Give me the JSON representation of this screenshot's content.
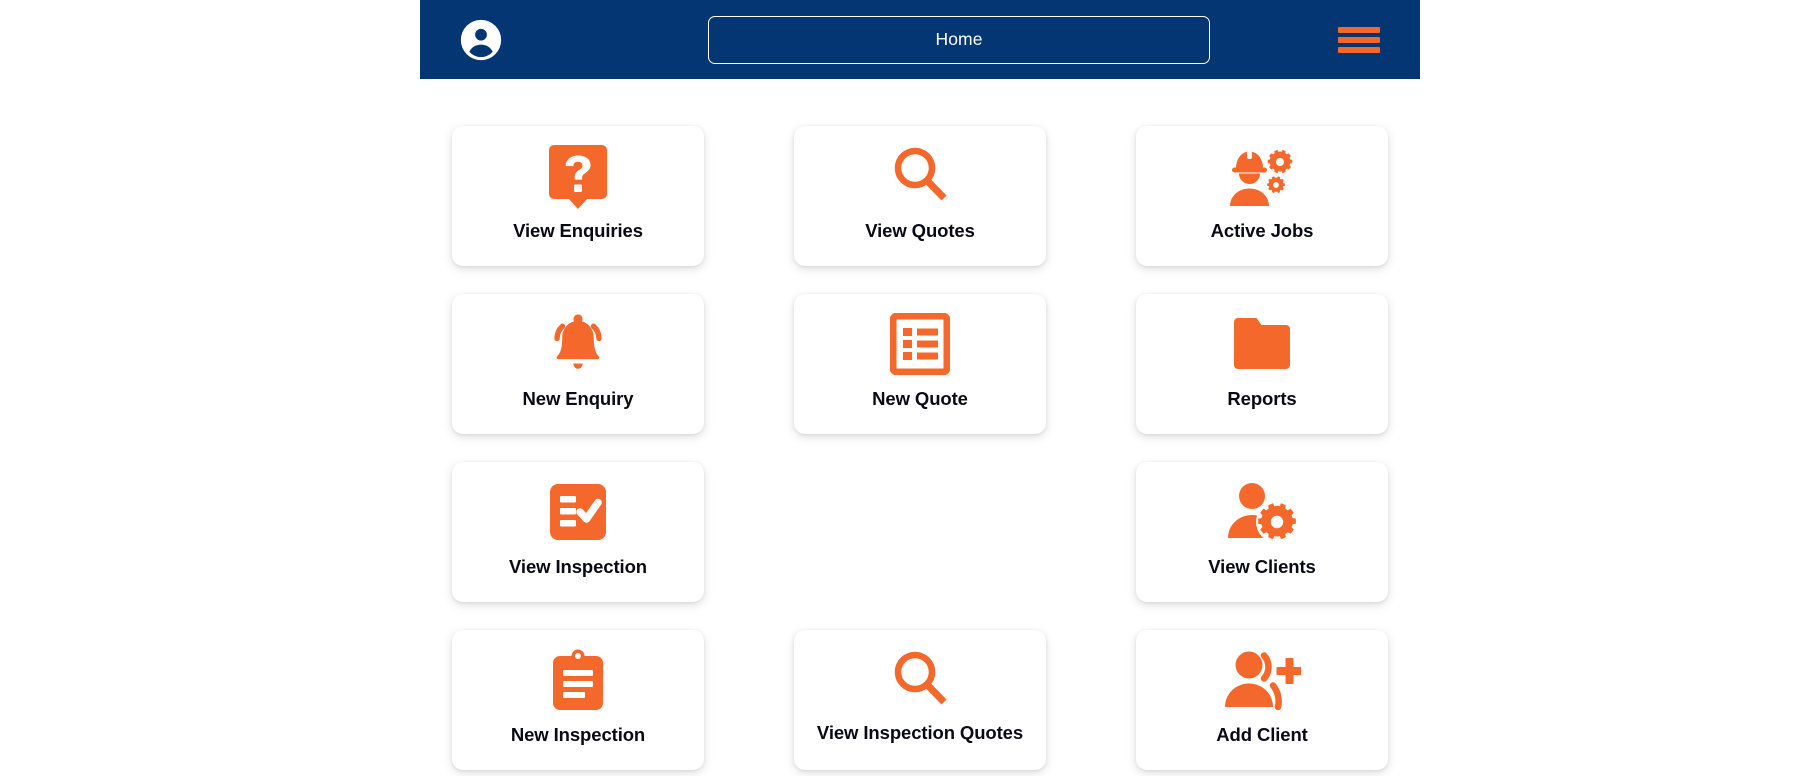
{
  "theme": {
    "header_bg": "#033673",
    "accent_orange": "#F4692B",
    "card_bg": "#FFFFFF",
    "label_color": "#0A0A14",
    "page_bg": "#FFFFFF"
  },
  "header": {
    "avatar_icon": "account-circle-icon",
    "tab_label": "Home",
    "menu_icon": "hamburger-menu-icon"
  },
  "grid": {
    "cards": [
      {
        "id": "view-enquiries",
        "label": "View Enquiries",
        "icon": "question-speech-bubble-icon",
        "empty": false
      },
      {
        "id": "view-quotes",
        "label": "View Quotes",
        "icon": "magnifier-icon",
        "empty": false
      },
      {
        "id": "active-jobs",
        "label": "Active Jobs",
        "icon": "worker-gears-icon",
        "empty": false
      },
      {
        "id": "new-enquiry",
        "label": "New Enquiry",
        "icon": "ringing-bell-icon",
        "empty": false
      },
      {
        "id": "new-quote",
        "label": "New Quote",
        "icon": "list-form-icon",
        "empty": false
      },
      {
        "id": "reports",
        "label": "Reports",
        "icon": "folder-icon",
        "empty": false
      },
      {
        "id": "view-inspection",
        "label": "View Inspection",
        "icon": "checklist-check-icon",
        "empty": false
      },
      {
        "id": "empty-slot",
        "label": "",
        "icon": "",
        "empty": true
      },
      {
        "id": "view-clients",
        "label": "View Clients",
        "icon": "person-gear-icon",
        "empty": false
      },
      {
        "id": "new-inspection",
        "label": "New Inspection",
        "icon": "clipboard-icon",
        "empty": false
      },
      {
        "id": "view-inspection-quotes",
        "label": "View Inspection Quotes",
        "icon": "magnifier-icon",
        "empty": false
      },
      {
        "id": "add-client",
        "label": "Add Client",
        "icon": "person-add-icon",
        "empty": false
      }
    ]
  }
}
